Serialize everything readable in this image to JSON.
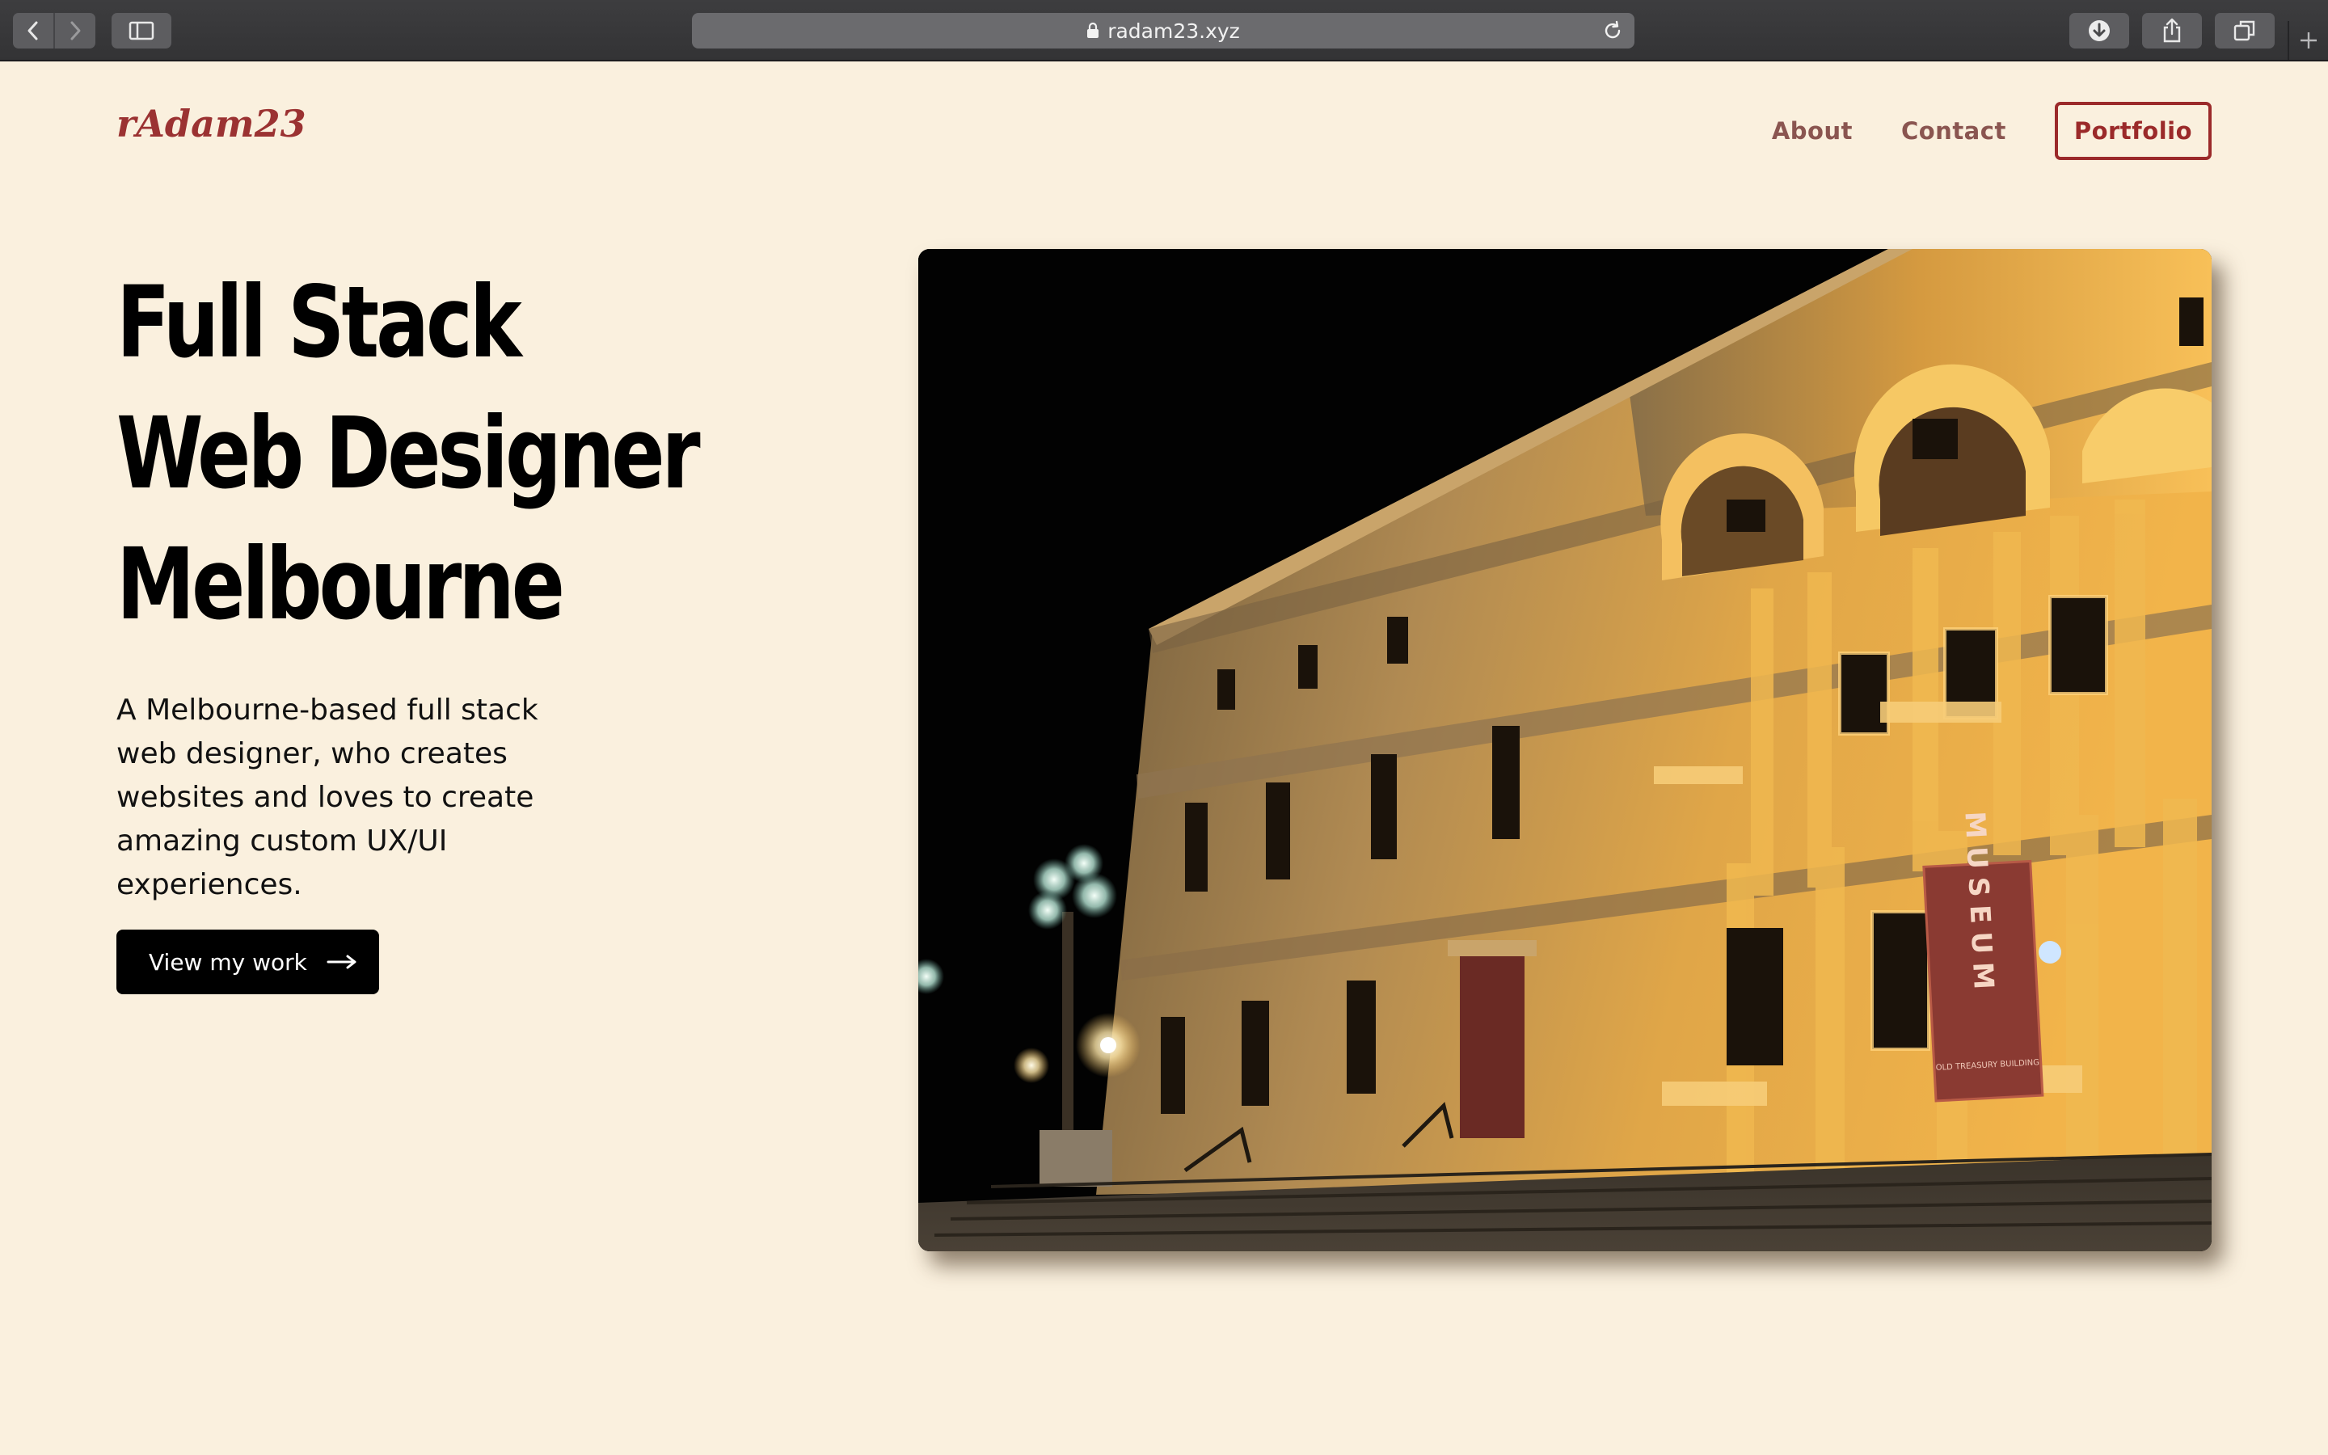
{
  "browser": {
    "url": "radam23.xyz",
    "icons": {
      "back": "chevron-left-icon",
      "forward": "chevron-right-icon",
      "sidebar": "sidebar-icon",
      "lock": "lock-icon",
      "reload": "reload-icon",
      "download": "download-icon",
      "share": "share-icon",
      "tabs": "tabs-icon",
      "new_tab": "plus-icon"
    }
  },
  "site": {
    "logo": "rAdam23",
    "nav": {
      "about": "About",
      "contact": "Contact",
      "portfolio": "Portfolio"
    }
  },
  "hero": {
    "title_lines": [
      "Full Stack",
      "Web Designer",
      "Melbourne"
    ],
    "description": "A Melbourne-based full stack web designer, who creates websites and loves to create amazing custom UX/UI experiences.",
    "cta_label": "View my work",
    "cta_icon": "arrow-right-icon",
    "image_alt": "Old Treasury Building museum facade at night",
    "banner_text": "MUSEUM",
    "banner_subtext": "OLD TREASURY BUILDING"
  },
  "colors": {
    "background": "#faf0de",
    "brand": "#9b3232",
    "nav_text": "#8a5550",
    "cta_bg": "#000000"
  }
}
